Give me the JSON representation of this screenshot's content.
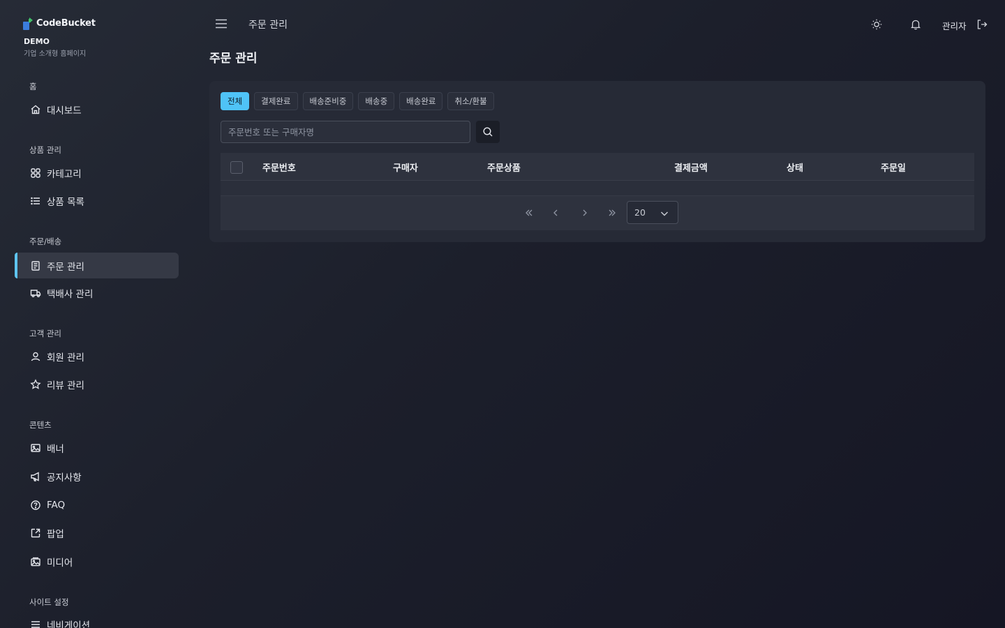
{
  "brand": {
    "name": "CodeBucket",
    "demo": "DEMO",
    "subtitle": "기업 소개형 홈페이지"
  },
  "sidebar": {
    "sections": [
      {
        "title": "홈",
        "items": [
          {
            "label": "대시보드",
            "icon": "home-icon"
          }
        ]
      },
      {
        "title": "상품 관리",
        "items": [
          {
            "label": "카테고리",
            "icon": "grid-icon"
          },
          {
            "label": "상품 목록",
            "icon": "list-icon"
          }
        ]
      },
      {
        "title": "주문/배송",
        "items": [
          {
            "label": "주문 관리",
            "icon": "receipt-icon",
            "active": true
          },
          {
            "label": "택배사 관리",
            "icon": "truck-icon"
          }
        ]
      },
      {
        "title": "고객 관리",
        "items": [
          {
            "label": "회원 관리",
            "icon": "user-icon"
          },
          {
            "label": "리뷰 관리",
            "icon": "star-icon"
          }
        ]
      },
      {
        "title": "콘텐츠",
        "items": [
          {
            "label": "배너",
            "icon": "image-icon"
          },
          {
            "label": "공지사항",
            "icon": "megaphone-icon"
          },
          {
            "label": "FAQ",
            "icon": "help-circle-icon"
          },
          {
            "label": "팝업",
            "icon": "popup-icon"
          },
          {
            "label": "미디어",
            "icon": "media-icon"
          }
        ]
      },
      {
        "title": "사이트 설정",
        "items": [
          {
            "label": "네비게이션",
            "icon": "menu-icon"
          }
        ]
      }
    ]
  },
  "topbar": {
    "title": "주문 관리",
    "user": "관리자"
  },
  "page": {
    "title": "주문 관리"
  },
  "filters": {
    "tabs": [
      "전체",
      "결제완료",
      "배송준비중",
      "배송중",
      "배송완료",
      "취소/환불"
    ],
    "active": "전체"
  },
  "search": {
    "placeholder": "주문번호 또는 구매자명",
    "value": ""
  },
  "table": {
    "columns": [
      "주문번호",
      "구매자",
      "주문상품",
      "결제금액",
      "상태",
      "주문일"
    ],
    "rows": []
  },
  "pagination": {
    "page_size": "20"
  },
  "colors": {
    "accent": "#4fc3f7",
    "active_bg": "#353945",
    "card_bg": "#262a36"
  }
}
